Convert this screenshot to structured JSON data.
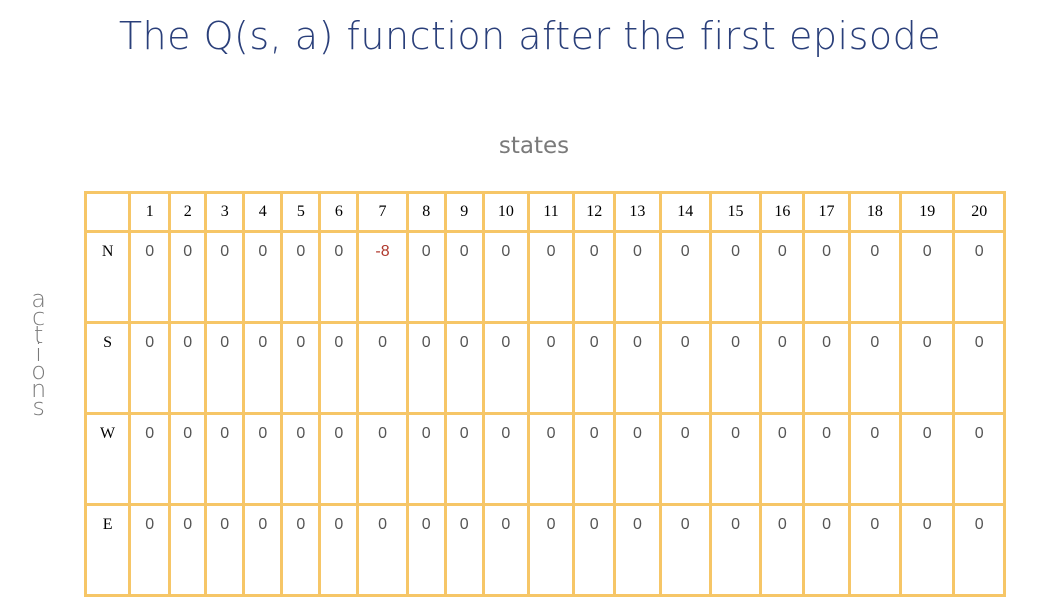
{
  "title": "The Q(s, a) function after the first episode",
  "states_label": "states",
  "actions_label": "actions",
  "colors": {
    "grid": "#f6c667",
    "title": "#2a3f7a",
    "negative": "#b03a2e"
  },
  "table": {
    "states": [
      "1",
      "2",
      "3",
      "4",
      "5",
      "6",
      "7",
      "8",
      "9",
      "10",
      "11",
      "12",
      "13",
      "14",
      "15",
      "16",
      "17",
      "18",
      "19",
      "20"
    ],
    "rows": [
      {
        "action": "N",
        "values": [
          "0",
          "0",
          "0",
          "0",
          "0",
          "0",
          "-8",
          "0",
          "0",
          "0",
          "0",
          "0",
          "0",
          "0",
          "0",
          "0",
          "0",
          "0",
          "0",
          "0"
        ]
      },
      {
        "action": "S",
        "values": [
          "0",
          "0",
          "0",
          "0",
          "0",
          "0",
          "0",
          "0",
          "0",
          "0",
          "0",
          "0",
          "0",
          "0",
          "0",
          "0",
          "0",
          "0",
          "0",
          "0"
        ]
      },
      {
        "action": "W",
        "values": [
          "0",
          "0",
          "0",
          "0",
          "0",
          "0",
          "0",
          "0",
          "0",
          "0",
          "0",
          "0",
          "0",
          "0",
          "0",
          "0",
          "0",
          "0",
          "0",
          "0"
        ]
      },
      {
        "action": "E",
        "values": [
          "0",
          "0",
          "0",
          "0",
          "0",
          "0",
          "0",
          "0",
          "0",
          "0",
          "0",
          "0",
          "0",
          "0",
          "0",
          "0",
          "0",
          "0",
          "0",
          "0"
        ]
      }
    ]
  }
}
